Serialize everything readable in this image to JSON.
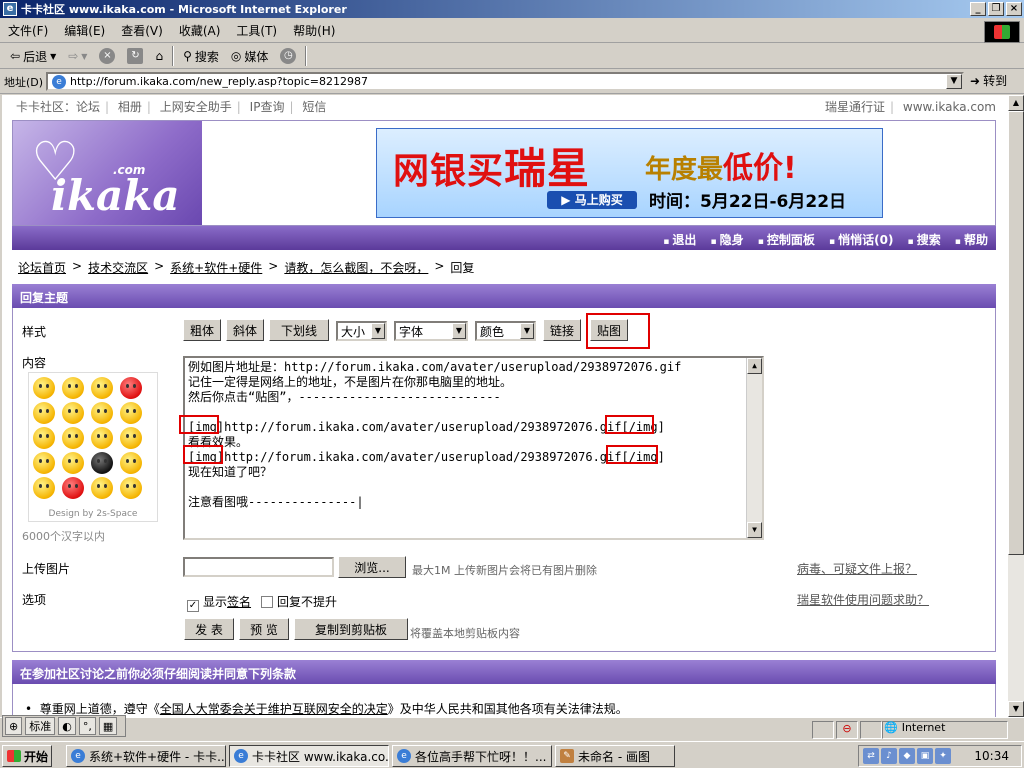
{
  "window": {
    "title": "卡卡社区 www.ikaka.com - Microsoft Internet Explorer",
    "icon": "ie-icon"
  },
  "menu": [
    "文件(F)",
    "编辑(E)",
    "查看(V)",
    "收藏(A)",
    "工具(T)",
    "帮助(H)"
  ],
  "toolbar": {
    "back": "后退",
    "search": "搜索",
    "media": "媒体"
  },
  "address": {
    "label": "地址(D)",
    "url": "http://forum.ikaka.com/new_reply.asp?topic=8212987",
    "go": "转到"
  },
  "topnav": {
    "left": [
      "卡卡社区：论坛",
      "相册",
      "上网安全助手",
      "IP查询",
      "短信"
    ],
    "right": [
      "瑞星通行证",
      "www.ikaka.com"
    ]
  },
  "logo": {
    "word": "ikaka",
    "com": ".com"
  },
  "banner": {
    "part1": "网银买",
    "part2": "瑞星",
    "part3": "年度最",
    "part4": "低价",
    "part5": "!",
    "button": "▶ 马上购买",
    "period": "时间：5月22日-6月22日"
  },
  "nav_links": [
    "退出",
    "隐身",
    "控制面板",
    "悄悄话(0)",
    "搜索",
    "帮助"
  ],
  "breadcrumb": [
    "论坛首页",
    "技术交流区",
    "系统+软件+硬件",
    "请教，怎么截图，不会呀，",
    "回复"
  ],
  "reply": {
    "section_title": "回复主题",
    "style_label": "样式",
    "content_label": "内容",
    "limit": "6000个汉字以内",
    "buttons": {
      "bold": "粗体",
      "italic": "斜体",
      "underline": "下划线",
      "link": "链接",
      "image": "贴图"
    },
    "selects": {
      "size": "大小",
      "font": "字体",
      "color": "颜色"
    },
    "emote_caption": "Design by 2s-Space",
    "body_lines": [
      "例如图片地址是：http://forum.ikaka.com/avater/userupload/2938972076.gif",
      "记住一定得是网络上的地址，不是图片在你那电脑里的地址。",
      "然后你点击“贴图”，----------------------------",
      "",
      "[img]http://forum.ikaka.com/avater/userupload/2938972076.gif[/img]",
      "看看效果。",
      "[img]http://forum.ikaka.com/avater/userupload/2938972076.gif[/img]",
      "现在知道了吧？",
      "",
      "注意看图哦---------------|"
    ],
    "upload_label": "上传图片",
    "browse": "浏览...",
    "upload_hint": "最大1M 上传新图片会将已有图片删除",
    "report_link": "病毒、可疑文件上报？",
    "options_label": "选项",
    "show_signature": "显示",
    "signature_link": "签名",
    "no_bump": "回复不提升",
    "help_link": "瑞星软件使用问题求助？",
    "submit": "发 表",
    "preview": "预 览",
    "copy": "复制到剪贴板",
    "copy_hint": "将覆盖本地剪贴板内容"
  },
  "terms": {
    "title": "在参加社区讨论之前你必须仔细阅读并同意下列条款",
    "line_prefix": "尊重网上道德，遵守《",
    "line_link": "全国人大常委会关于维护互联网安全的决定",
    "line_suffix": "》及中华人民共和国其他各项有关法律法规。"
  },
  "ime": {
    "mode": "标准"
  },
  "status": {
    "zone": "Internet"
  },
  "taskbar": {
    "start": "开始",
    "tasks": [
      "系统+软件+硬件 - 卡卡...",
      "卡卡社区 www.ikaka.co...",
      "各位高手帮下忙呀！！...",
      "未命名 - 画图"
    ],
    "clock": "10:34"
  }
}
